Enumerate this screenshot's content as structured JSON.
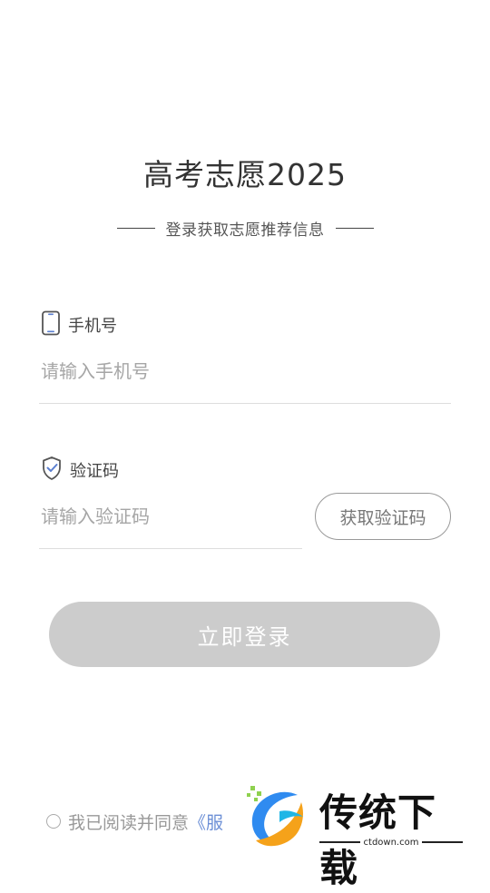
{
  "header": {
    "title": "高考志愿2025",
    "subtitle": "登录获取志愿推荐信息"
  },
  "phone": {
    "label": "手机号",
    "placeholder": "请输入手机号",
    "value": ""
  },
  "code": {
    "label": "验证码",
    "placeholder": "请输入验证码",
    "value": "",
    "get_code_label": "获取验证码"
  },
  "login": {
    "label": "立即登录"
  },
  "agreement": {
    "text": "我已阅读并同意",
    "link_text": "《服",
    "checked": false
  },
  "watermark": {
    "brand": "传统下载",
    "domain": "ctdown.com"
  },
  "colors": {
    "accent_link": "#6c8fd6",
    "icon_blue": "#5b7fd0",
    "button_disabled": "#cccccc"
  }
}
